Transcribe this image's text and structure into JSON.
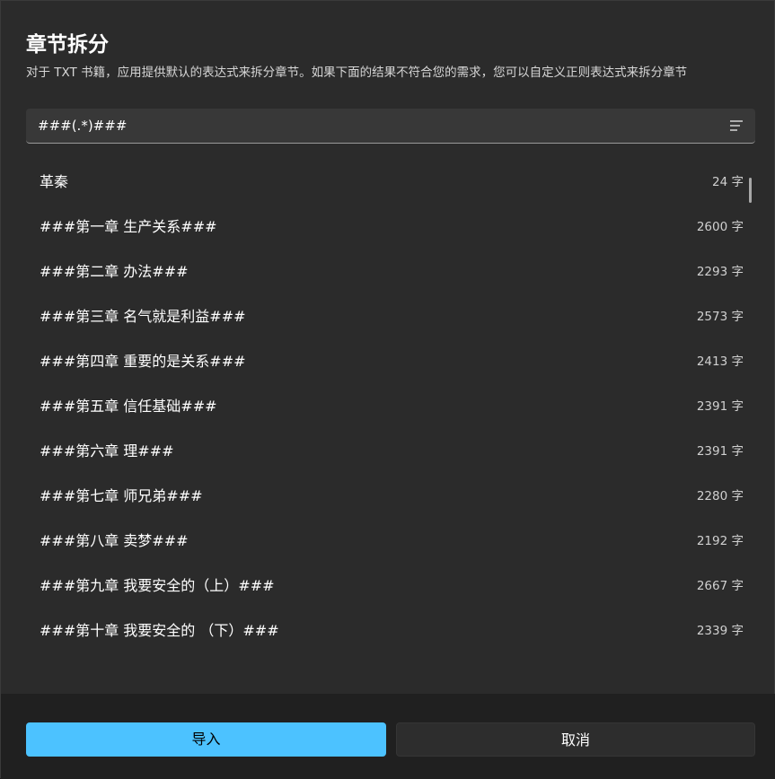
{
  "dialog": {
    "title": "章节拆分",
    "description": "对于 TXT 书籍，应用提供默认的表达式来拆分章节。如果下面的结果不符合您的需求，您可以自定义正则表达式来拆分章节"
  },
  "regex": {
    "value": "###(.*)###",
    "menu_icon": "list-menu-icon"
  },
  "chapters": [
    {
      "title": "革秦",
      "count": "24 字"
    },
    {
      "title": "###第一章 生产关系###",
      "count": "2600 字"
    },
    {
      "title": "###第二章 办法###",
      "count": "2293 字"
    },
    {
      "title": "###第三章 名气就是利益###",
      "count": "2573 字"
    },
    {
      "title": "###第四章 重要的是关系###",
      "count": "2413 字"
    },
    {
      "title": "###第五章 信任基础###",
      "count": "2391 字"
    },
    {
      "title": "###第六章 理###",
      "count": "2391 字"
    },
    {
      "title": "###第七章 师兄弟###",
      "count": "2280 字"
    },
    {
      "title": "###第八章 卖梦###",
      "count": "2192 字"
    },
    {
      "title": "###第九章 我要安全的（上）###",
      "count": "2667 字"
    },
    {
      "title": "###第十章 我要安全的 （下）###",
      "count": "2339 字"
    }
  ],
  "footer": {
    "import_label": "导入",
    "cancel_label": "取消"
  },
  "colors": {
    "accent": "#4cc2ff",
    "background": "#2b2b2b",
    "footer_background": "#202020"
  }
}
